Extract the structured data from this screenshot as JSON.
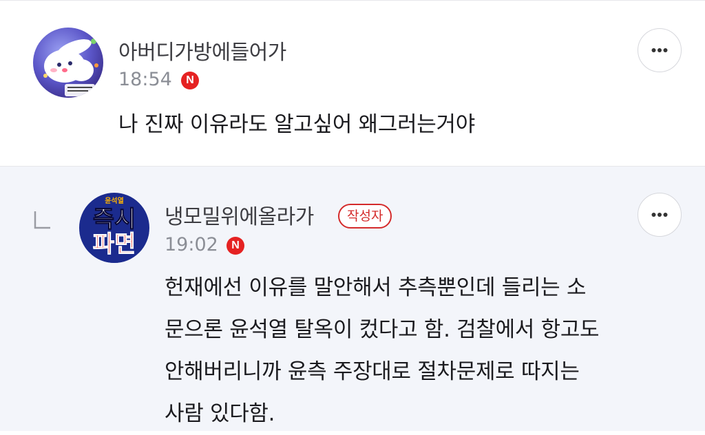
{
  "comments": [
    {
      "nickname": "아버디가방에들어가",
      "time": "18:54",
      "n_badge": "N",
      "avatar_icon": "bunny-illustration-avatar",
      "more_icon": "more-dots-icon",
      "text": [
        "나 진짜 이유라도 알고싶어 왜그러는거야"
      ]
    },
    {
      "is_reply": true,
      "nickname": "냉모밀위에올라가",
      "author_badge": "작성자",
      "time": "19:02",
      "n_badge": "N",
      "avatar_icon": "poster-avatar",
      "avatar_text": {
        "top": "윤석열",
        "line1": "즉시",
        "line2": "파면"
      },
      "more_icon": "more-dots-icon",
      "text": [
        "헌재에선 이유를 말안해서 추측뿐인데 들리는 소",
        "문으론 윤석열 탈옥이 컸다고 함. 검찰에서 항고도",
        "안해버리니까 윤측 주장대로 절차문제로 따지는",
        "사람 있다함."
      ]
    }
  ],
  "colors": {
    "reply_background": "#f3f5fa",
    "author_badge": "#d42a2a",
    "new_badge": "#e52222",
    "time_text": "#8b8e96"
  }
}
